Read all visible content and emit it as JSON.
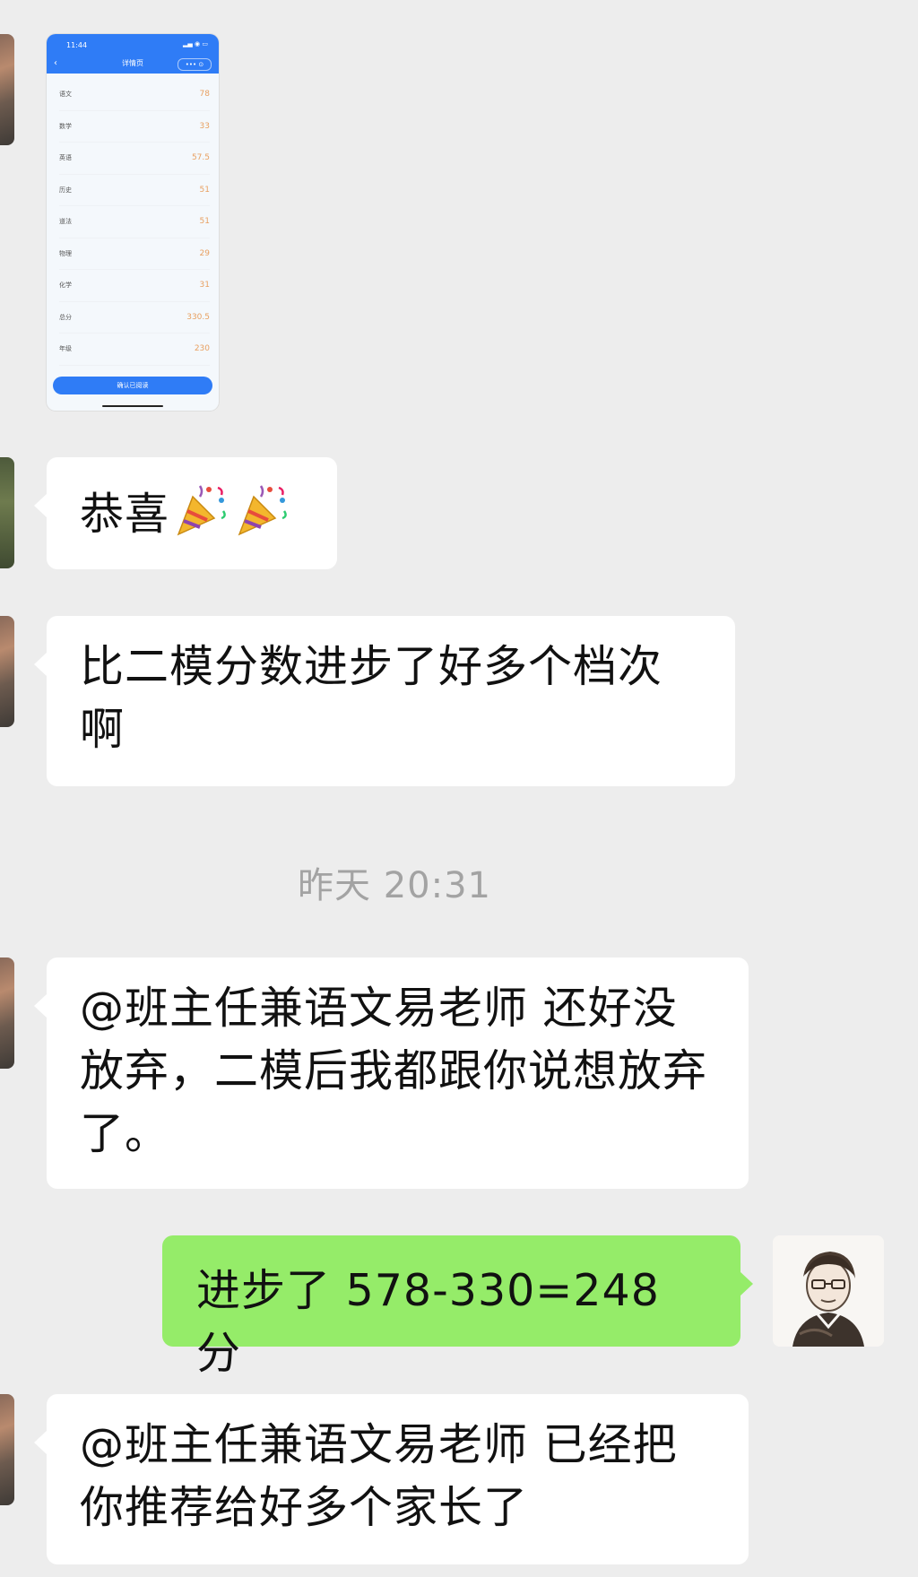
{
  "screenshot_card": {
    "time": "11:44",
    "status_icons": "▂▄ ◉ ▭",
    "nav_back": "‹",
    "nav_title": "详情页",
    "capsule": "••• ⊙",
    "rows": [
      {
        "label": "语文",
        "value": "78"
      },
      {
        "label": "数学",
        "value": "33"
      },
      {
        "label": "英语",
        "value": "57.5"
      },
      {
        "label": "历史",
        "value": "51"
      },
      {
        "label": "道法",
        "value": "51"
      },
      {
        "label": "物理",
        "value": "29"
      },
      {
        "label": "化学",
        "value": "31"
      },
      {
        "label": "总分",
        "value": "330.5"
      },
      {
        "label": "年级",
        "value": "230"
      }
    ],
    "button": "确认已阅读"
  },
  "messages": {
    "congrats": "恭喜",
    "progress_note": "比二模分数进步了好多个档次啊",
    "timestamp": "昨天 20:31",
    "mention_1": "@班主任兼语文易老师 还好没放弃，二模后我都跟你说想放弃了。",
    "reply": "进步了 578-330=248 分",
    "mention_2": "@班主任兼语文易老师 已经把你推荐给好多个家长了"
  },
  "colors": {
    "chat_background": "#ededed",
    "incoming_bubble": "#ffffff",
    "outgoing_bubble": "#95ec69",
    "screenshot_accent": "#2f7cf6",
    "score_value": "#e8a061"
  },
  "icons": {
    "emoji": "party-popper-icon"
  }
}
